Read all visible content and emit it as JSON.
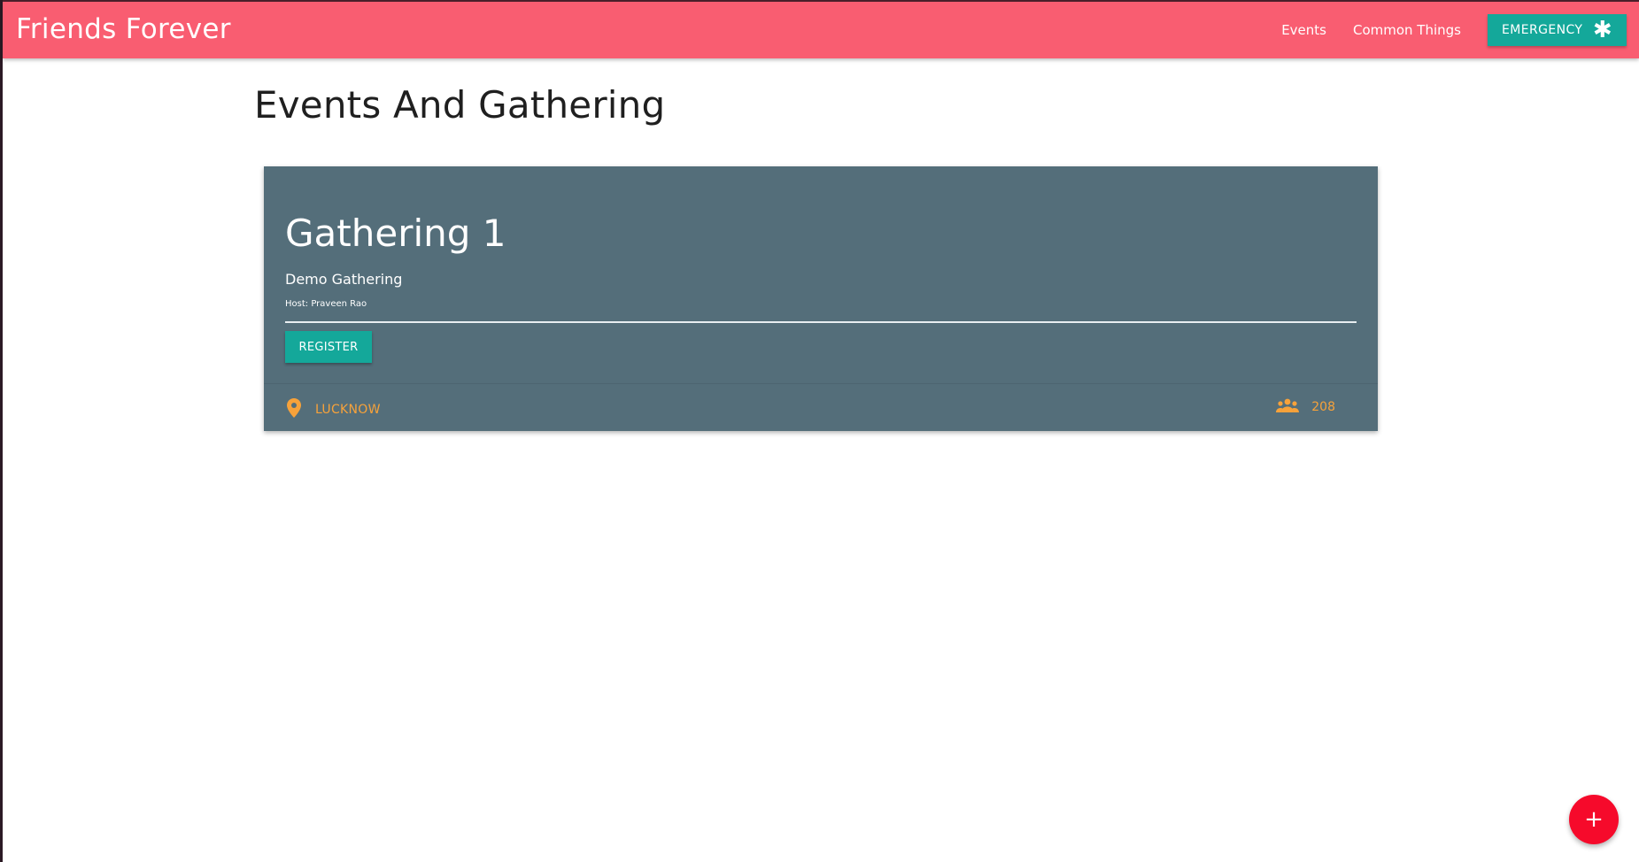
{
  "navbar": {
    "brand": "Friends Forever",
    "links": [
      {
        "label": "Events"
      },
      {
        "label": "Common Things"
      }
    ],
    "emergency": {
      "label": "EMERGENCY",
      "icon": "asterisk-icon"
    },
    "color": "#f95d71"
  },
  "page": {
    "title": "Events And Gathering"
  },
  "events": [
    {
      "title": "Gathering 1",
      "subtitle": "Demo Gathering",
      "host": "Host: Praveen Rao",
      "register_label": "REGISTER",
      "location": "LUCKNOW",
      "location_icon": "map-pin-icon",
      "attendees": "208",
      "attendees_icon": "people-icon"
    }
  ],
  "fab": {
    "label": "+",
    "icon": "plus-icon"
  },
  "colors": {
    "accent_teal": "#14a89a",
    "card_bg": "#546e7a",
    "footer_text": "#f7a23a",
    "fab_red": "#f60a2b"
  }
}
